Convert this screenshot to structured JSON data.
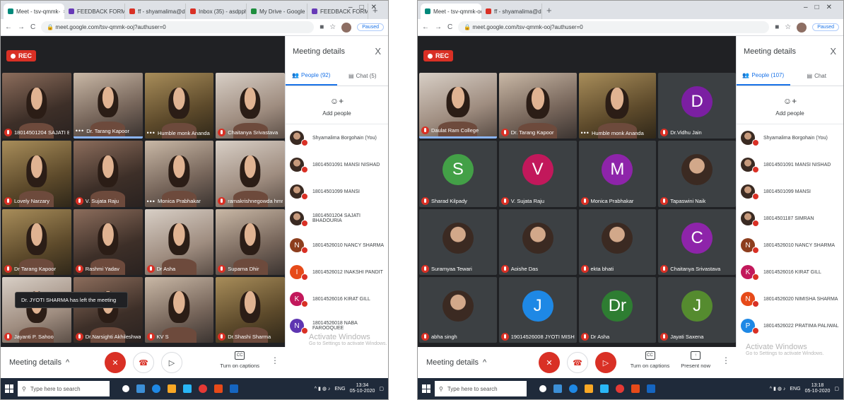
{
  "left": {
    "tabs": [
      {
        "label": "Meet - tsv-qmmk-",
        "active": true,
        "color": "#00897b"
      },
      {
        "label": "FEEDBACK FORM FOR",
        "active": false,
        "color": "#673ab7"
      },
      {
        "label": "ff - shyamalima@dr.du.",
        "active": false,
        "color": "#d93025"
      },
      {
        "label": "Inbox (35) - asdpphilo...",
        "active": false,
        "color": "#d93025"
      },
      {
        "label": "My Drive - Google Dri...",
        "active": false,
        "color": "#1e8e3e"
      },
      {
        "label": "FEEDBACK FORM FOR",
        "active": false,
        "color": "#673ab7"
      }
    ],
    "url": "meet.google.com/tsv-qmmk-ooj?authuser=0",
    "paused": "Paused",
    "rec": "REC",
    "tiles": [
      {
        "name": "18014501204 SAJATI BHADOU...",
        "kind": "video",
        "style": "a"
      },
      {
        "name": "Dr. Tarang Kapoor",
        "kind": "video",
        "style": "b",
        "speaking": true,
        "dots": true
      },
      {
        "name": "Humble monk Ananda",
        "kind": "video",
        "style": "c",
        "dots": true
      },
      {
        "name": "Chaitanya Srivastava",
        "kind": "video",
        "style": "d"
      },
      {
        "name": "Lovely Narzary",
        "kind": "video",
        "style": "c"
      },
      {
        "name": "V. Sujata Raju",
        "kind": "video",
        "style": "a"
      },
      {
        "name": "Monica Prabhakar",
        "kind": "video",
        "style": "b",
        "dots": true
      },
      {
        "name": "ramakrishnegowda hmr",
        "kind": "video",
        "style": "d"
      },
      {
        "name": "Dr Tarang Kapoor",
        "kind": "video",
        "style": "c"
      },
      {
        "name": "Rashmi Yadav",
        "kind": "video",
        "style": "a"
      },
      {
        "name": "Dr Asha",
        "kind": "video",
        "style": "d"
      },
      {
        "name": "Suparna Dhir",
        "kind": "video",
        "style": "b"
      },
      {
        "name": "Jayanti P. Sahoo",
        "kind": "video",
        "style": "d"
      },
      {
        "name": "Dr.Narsighti Akhileshwaran Reddy",
        "kind": "video",
        "style": "a"
      },
      {
        "name": "KV S",
        "kind": "video",
        "style": "b"
      },
      {
        "name": "Dr.Shashi Sharma",
        "kind": "video",
        "style": "c"
      }
    ],
    "toast": "Dr. JYOTI SHARMA has left the meeting",
    "panel": {
      "title": "Meeting details",
      "people_tab": "People (92)",
      "chat_tab": "Chat (5)",
      "add_people": "Add people",
      "people": [
        {
          "name": "Shyamalima Borgohain (You)",
          "avatar": "img",
          "color": ""
        },
        {
          "name": "18014501091 MANSI NISHAD",
          "avatar": "img",
          "color": ""
        },
        {
          "name": "18014501099 MANSI",
          "avatar": "img",
          "color": ""
        },
        {
          "name": "18014501204 SAJATI BHADOURIA",
          "avatar": "img",
          "color": ""
        },
        {
          "name": "18014526010 NANCY SHARMA",
          "avatar": "N",
          "color": "#8d3e1e"
        },
        {
          "name": "18014526012 INAKSHI PANDIT",
          "avatar": "I",
          "color": "#e64a19"
        },
        {
          "name": "18014526016 KIRAT GILL",
          "avatar": "K",
          "color": "#c2185b"
        },
        {
          "name": "18014526018 NABA FAROOQUEE",
          "avatar": "N",
          "color": "#5e35b1"
        }
      ]
    },
    "controls": {
      "meeting_details": "Meeting details",
      "captions": "Turn on captions"
    },
    "watermark": {
      "title": "Activate Windows",
      "sub": "Go to Settings to activate Windows."
    },
    "taskbar": {
      "search": "Type here to search",
      "time": "13:34",
      "date": "05-10-2020",
      "lang": "ENG"
    }
  },
  "right": {
    "tabs": [
      {
        "label": "Meet - tsv-qmmk-ooj",
        "active": true,
        "color": "#00897b"
      },
      {
        "label": "ff - shyamalima@dr.du.ac.in - Dr...",
        "active": false,
        "color": "#d93025"
      }
    ],
    "url": "meet.google.com/tsv-qmmk-ooj?authuser=0",
    "paused": "Paused",
    "rec": "REC",
    "tiles": [
      {
        "name": "Daulat Ram College",
        "kind": "video",
        "style": "d",
        "speaking": true
      },
      {
        "name": "Dr. Tarang Kapoor",
        "kind": "video",
        "style": "b"
      },
      {
        "name": "Humble monk Ananda",
        "kind": "video",
        "style": "c",
        "dots": true
      },
      {
        "name": "Dr.Vidhu Jain",
        "kind": "initial",
        "letter": "D",
        "color": "#7b1fa2"
      },
      {
        "name": "Sharad Kilpady",
        "kind": "initial",
        "letter": "S",
        "color": "#43a047"
      },
      {
        "name": "V. Sujata Raju",
        "kind": "initial",
        "letter": "V",
        "color": "#c2185b"
      },
      {
        "name": "Monica Prabhakar",
        "kind": "initial",
        "letter": "M",
        "color": "#8e24aa"
      },
      {
        "name": "Tapaswini Naik",
        "kind": "photo"
      },
      {
        "name": "Suramyaa Tewari",
        "kind": "photo"
      },
      {
        "name": "Aoishe Das",
        "kind": "photo"
      },
      {
        "name": "ekta bhati",
        "kind": "photo"
      },
      {
        "name": "Chaitanya Srivastava",
        "kind": "initial",
        "letter": "C",
        "color": "#8e24aa"
      },
      {
        "name": "abha singh",
        "kind": "photo"
      },
      {
        "name": "19014526008 JYOTI MISHRA",
        "kind": "initial",
        "letter": "J",
        "color": "#1e88e5"
      },
      {
        "name": "Dr Asha",
        "kind": "initial",
        "letter": "Dr",
        "color": "#2e7d32"
      },
      {
        "name": "Jayati Saxena",
        "kind": "initial",
        "letter": "J",
        "color": "#558b2f"
      }
    ],
    "panel": {
      "title": "Meeting details",
      "people_tab": "People (107)",
      "chat_tab": "Chat",
      "add_people": "Add people",
      "people": [
        {
          "name": "Shyamalima Borgohain (You)",
          "avatar": "img",
          "color": ""
        },
        {
          "name": "18014501091 MANSI NISHAD",
          "avatar": "img",
          "color": ""
        },
        {
          "name": "18014501099 MANSI",
          "avatar": "img",
          "color": ""
        },
        {
          "name": "18014501187 SIMRAN",
          "avatar": "img",
          "color": ""
        },
        {
          "name": "18014526010 NANCY SHARMA",
          "avatar": "N",
          "color": "#8d3e1e"
        },
        {
          "name": "18014526016 KIRAT GILL",
          "avatar": "K",
          "color": "#c2185b"
        },
        {
          "name": "18014526020 NIMISHA SHARMA",
          "avatar": "N",
          "color": "#e64a19"
        },
        {
          "name": "18014526022 PRATIMA PALIWAL",
          "avatar": "P",
          "color": "#1e88e5"
        }
      ]
    },
    "controls": {
      "meeting_details": "Meeting details",
      "captions": "Turn on captions",
      "present": "Present now"
    },
    "watermark": {
      "title": "Activate Windows",
      "sub": "Go to Settings to activate Windows."
    },
    "taskbar": {
      "search": "Type here to search",
      "time": "13:18",
      "date": "05-10-2020",
      "lang": "ENG"
    }
  }
}
